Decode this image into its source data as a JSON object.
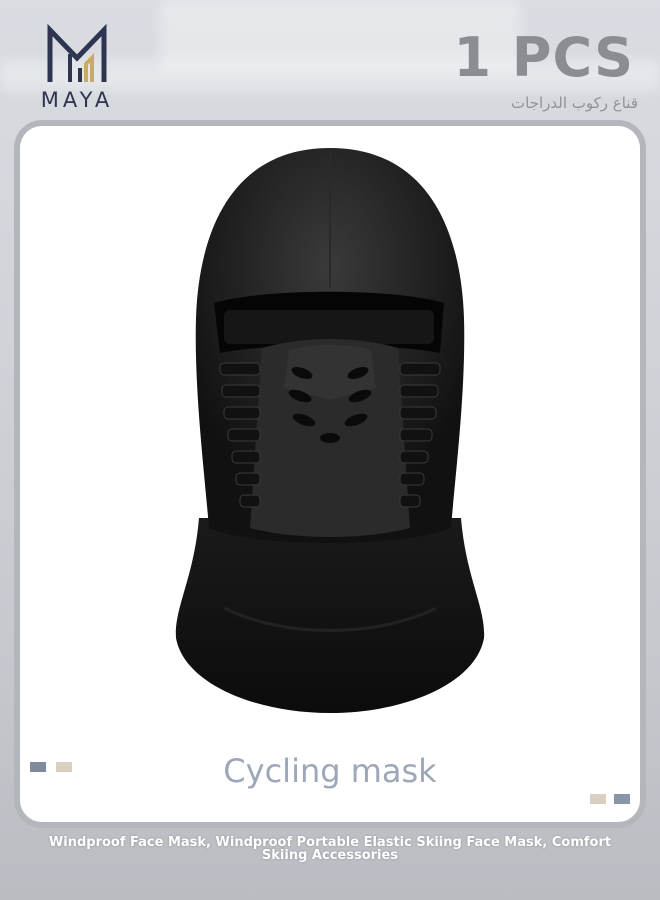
{
  "brand": {
    "name": "MAYA",
    "logo_icon": "maya-logo-icon"
  },
  "quantity": "1 PCS",
  "arabic_subtitle": "قناع ركوب الدراجات",
  "product": {
    "image_icon": "balaclava-mask-icon"
  },
  "caption": "Cycling mask",
  "swatches": {
    "left": [
      "#7f8a9c",
      "#d9d1c0"
    ],
    "right": [
      "#d9d1c0",
      "#8a96a8"
    ]
  },
  "footer_text": "Windproof Face Mask, Windproof Portable Elastic Skiing Face Mask, Comfort Skiing Accessories",
  "colors": {
    "accent": "#2e3550",
    "caption": "#9da7b8",
    "frame": "#b3b6ba"
  }
}
